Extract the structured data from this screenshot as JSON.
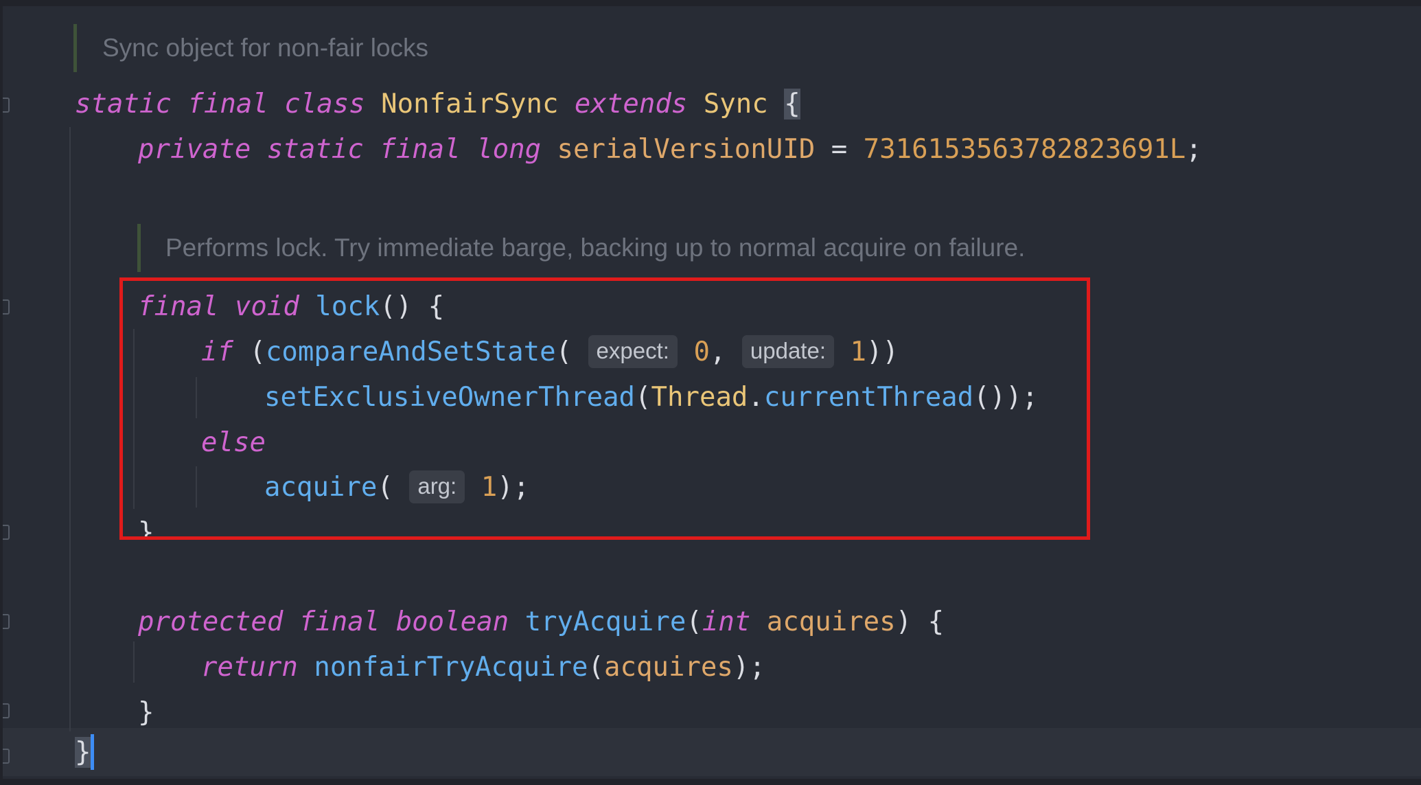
{
  "doc_comments": {
    "class": "Sync object for non-fair locks",
    "lock": "Performs lock. Try immediate barge, backing up to normal acquire on failure."
  },
  "code": {
    "l1": {
      "static": "static",
      "final": "final",
      "class": "class",
      "name": "NonfairSync",
      "extends": "extends",
      "super": "Sync",
      "brace": "{"
    },
    "l2": {
      "private": "private",
      "static": "static",
      "final": "final",
      "long": "long",
      "field": "serialVersionUID",
      "eq": " = ",
      "value": "7316153563782823691L",
      "semi": ";"
    },
    "l3": {
      "final": "final",
      "void": "void",
      "method": "lock",
      "rest": "() {"
    },
    "l4": {
      "if": "if",
      "open": " (",
      "method": "compareAndSetState",
      "paren": "(",
      "hint1": "expect:",
      "v1": "0",
      "comma": ", ",
      "hint2": "update:",
      "v2": "1",
      "close": "))"
    },
    "l5": {
      "method": "setExclusiveOwnerThread",
      "paren": "(",
      "cls": "Thread",
      "dot": ".",
      "call": "currentThread",
      "close": "());"
    },
    "l6": {
      "else": "else"
    },
    "l7": {
      "method": "acquire",
      "paren": "(",
      "hint": "arg:",
      "v": "1",
      "close": ");"
    },
    "l8": {
      "brace": "}"
    },
    "l9": {
      "protected": "protected",
      "final": "final",
      "boolean": "boolean",
      "method": "tryAcquire",
      "paren": "(",
      "int": "int",
      "param": "acquires",
      "close": ") {"
    },
    "l10": {
      "return": "return",
      "method": "nonfairTryAcquire",
      "paren": "(",
      "param": "acquires",
      "close": ");"
    },
    "l11": {
      "brace": "}"
    },
    "l12": {
      "brace": "}"
    }
  },
  "colors": {
    "background": "#282c35",
    "keyword": "#cf64cf",
    "class": "#eac678",
    "function": "#61aeee",
    "number": "#d9a056",
    "highlight_box": "#e01b1b"
  }
}
